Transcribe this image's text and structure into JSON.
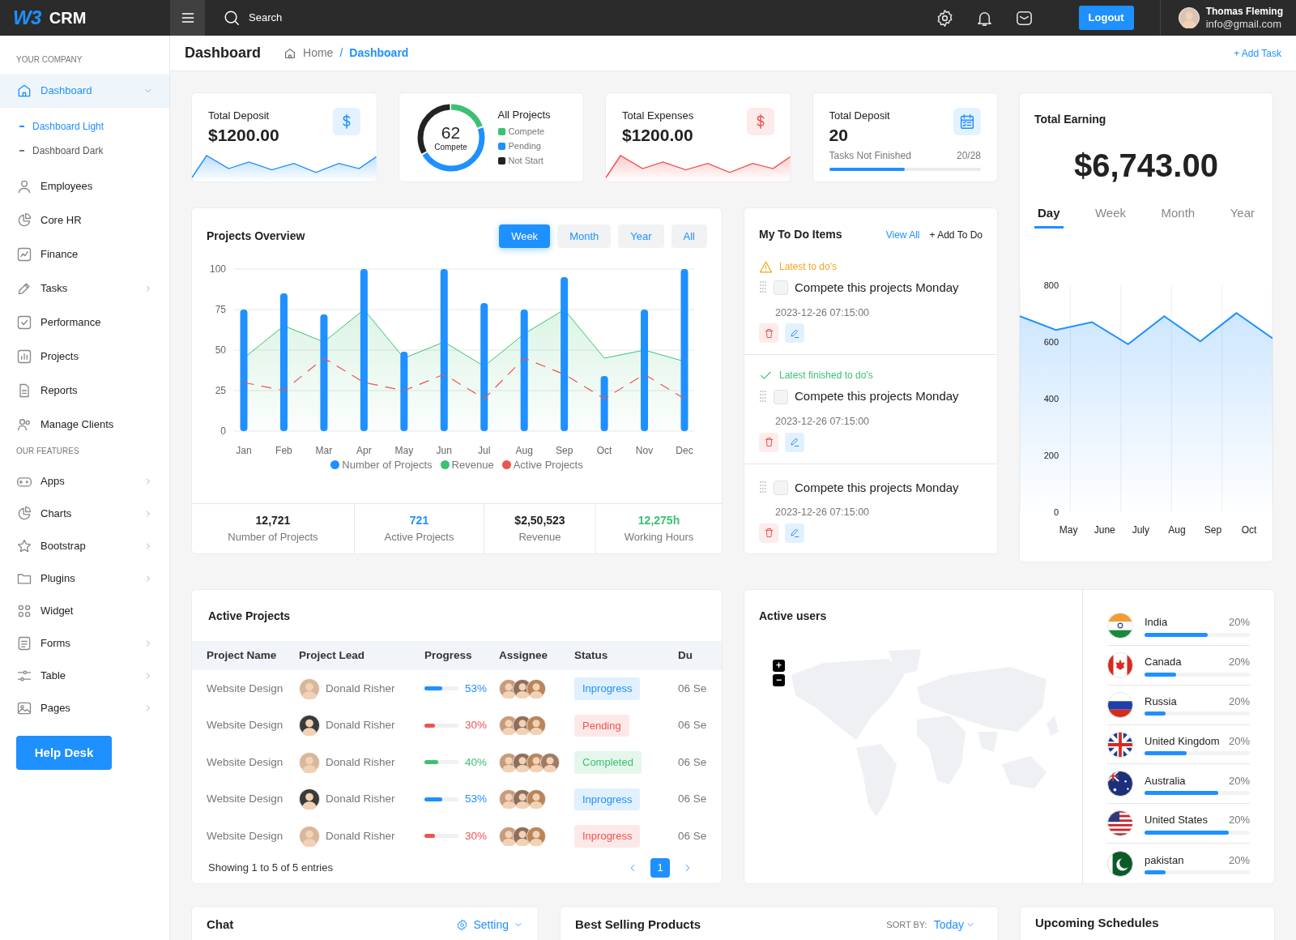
{
  "header": {
    "logo": "W3",
    "app_name": "CRM",
    "search": {
      "placeholder": "Search"
    },
    "logout": "Logout",
    "user": {
      "name": "Thomas Fleming",
      "email": "info@gmail.com"
    }
  },
  "sidebar": {
    "sections": [
      {
        "title": "YOUR COMPANY",
        "items": [
          {
            "label": "Dashboard",
            "selected": true,
            "expandable": true,
            "expanded": true,
            "children": [
              {
                "label": "Dashboard Light",
                "selected": true
              },
              {
                "label": "Dashboard Dark",
                "selected": false
              }
            ]
          },
          {
            "label": "Employees",
            "selected": false,
            "expandable": false
          },
          {
            "label": "Core HR",
            "selected": false,
            "expandable": false
          },
          {
            "label": "Finance",
            "selected": false,
            "expandable": false
          },
          {
            "label": "Tasks",
            "selected": false,
            "expandable": true,
            "expanded": false
          },
          {
            "label": "Performance",
            "selected": false,
            "expandable": false
          },
          {
            "label": "Projects",
            "selected": false,
            "expandable": false
          },
          {
            "label": "Reports",
            "selected": false,
            "expandable": false
          },
          {
            "label": "Manage Clients",
            "selected": false,
            "expandable": false
          }
        ]
      },
      {
        "title": "OUR FEATURES",
        "items": [
          {
            "label": "Apps",
            "selected": false,
            "expandable": true,
            "expanded": false
          },
          {
            "label": "Charts",
            "selected": false,
            "expandable": true,
            "expanded": false
          },
          {
            "label": "Bootstrap",
            "selected": false,
            "expandable": true,
            "expanded": false
          },
          {
            "label": "Plugins",
            "selected": false,
            "expandable": true,
            "expanded": false
          },
          {
            "label": "Widget",
            "selected": false,
            "expandable": false
          },
          {
            "label": "Forms",
            "selected": false,
            "expandable": true,
            "expanded": false
          },
          {
            "label": "Table",
            "selected": false,
            "expandable": true,
            "expanded": false
          },
          {
            "label": "Pages",
            "selected": false,
            "expandable": true,
            "expanded": false
          }
        ]
      }
    ],
    "help_button": "Help Desk"
  },
  "page_header": {
    "title": "Dashboard",
    "breadcrumb": [
      {
        "label": "Home",
        "selected": false
      },
      {
        "label": "Dashboard",
        "selected": true
      }
    ],
    "separator": "/",
    "add_task": "+ Add Task"
  },
  "stat_cards": [
    {
      "kind": "sparkline",
      "title": "Total Deposit",
      "value": "$1200.00",
      "color": "#1e90ff"
    },
    {
      "kind": "donut",
      "center_value": "62",
      "center_label": "Compete",
      "title": "All Projects",
      "legend": [
        {
          "label": "Compete",
          "color": "#3cc172"
        },
        {
          "label": "Pending",
          "color": "#1e90ff"
        },
        {
          "label": "Not Start",
          "color": "#222222"
        }
      ]
    },
    {
      "kind": "sparkline",
      "title": "Total Expenses",
      "value": "$1200.00",
      "color": "#ef5350"
    },
    {
      "kind": "tasks",
      "title": "Total Deposit",
      "value": "20",
      "caption": "Tasks Not Finished",
      "reading": "20/28",
      "level": 0.5
    }
  ],
  "projects_overview": {
    "title": "Projects Overview",
    "tabs": [
      {
        "label": "Week",
        "selected": true
      },
      {
        "label": "Month",
        "selected": false
      },
      {
        "label": "Year",
        "selected": false
      },
      {
        "label": "All",
        "selected": false
      }
    ],
    "chart_data": {
      "type": "bar",
      "grid": true,
      "categories": [
        "Jan",
        "Feb",
        "Mar",
        "Apr",
        "May",
        "Jun",
        "Jul",
        "Aug",
        "Sep",
        "Oct",
        "Nov",
        "Dec"
      ],
      "ylim": [
        0,
        100
      ],
      "yticks": [
        0,
        25,
        50,
        75,
        100
      ],
      "series": [
        {
          "name": "Number of Projects",
          "color": "#1e90ff",
          "values": [
            75,
            85,
            72,
            100,
            49,
            100,
            79,
            75,
            95,
            34,
            75,
            100
          ]
        },
        {
          "name": "Revenue",
          "color": "#3cc172",
          "type": "area",
          "values": [
            45,
            65,
            55,
            75,
            45,
            55,
            40,
            60,
            75,
            45,
            50,
            43
          ]
        },
        {
          "name": "Active Projects",
          "color": "#ef5350",
          "type": "line",
          "line_style": "dashed",
          "values": [
            30,
            25,
            45,
            30,
            25,
            35,
            20,
            45,
            35,
            20,
            35,
            20
          ]
        }
      ]
    },
    "stats": [
      {
        "value": "12,721",
        "label": "Number of Projects",
        "color": "#222222"
      },
      {
        "value": "721",
        "label": "Active Projects",
        "color": "#1e90ff"
      },
      {
        "value": "$2,50,523",
        "label": "Revenue",
        "color": "#222222"
      },
      {
        "value": "12,275h",
        "label": "Working Hours",
        "color": "#3cc172"
      }
    ]
  },
  "todo": {
    "title": "My To Do Items",
    "view_all": "View All",
    "add": "+ Add To Do",
    "groups": [
      {
        "heading": {
          "kind": "warning",
          "text": "Latest to do's"
        },
        "task": "Compete this projects Monday",
        "checked": false,
        "date": "2023-12-26 07:15:00"
      },
      {
        "heading": {
          "kind": "done",
          "text": "Latest finished to do's"
        },
        "task": "Compete this projects Monday",
        "checked": false,
        "date": "2023-12-26 07:15:00"
      },
      {
        "task": "Compete this projects Monday",
        "checked": false,
        "date": "2023-12-26 07:15:00"
      }
    ]
  },
  "earning": {
    "title": "Total Earning",
    "amount": "$6,743.00",
    "tabs": [
      {
        "label": "Day",
        "selected": true
      },
      {
        "label": "Week",
        "selected": false
      },
      {
        "label": "Month",
        "selected": false
      },
      {
        "label": "Year",
        "selected": false
      }
    ],
    "chart_data": {
      "type": "area",
      "categories": [
        null,
        "May",
        "June",
        "July",
        "Aug",
        "Sep",
        "Oct",
        null
      ],
      "ylim": [
        0,
        800
      ],
      "yticks": [
        0,
        200,
        400,
        600,
        800
      ],
      "series": [
        {
          "color": "#1e90ff",
          "values": [
            691,
            642,
            670,
            592,
            691,
            602,
            702,
            613
          ]
        }
      ]
    }
  },
  "active_projects": {
    "title": "Active Projects",
    "columns": [
      "Project Name",
      "Project Lead",
      "Progress",
      "Assignee",
      "Status",
      "Du"
    ],
    "rows": [
      {
        "name": "Website Design",
        "lead": "Donald Risher",
        "progress": {
          "level": 0.53,
          "text": "53%",
          "color": "#1e90ff"
        },
        "status": {
          "text": "Inprogress",
          "color": "#1e90ff"
        },
        "due": "06 Se"
      },
      {
        "name": "Website Design",
        "lead": "Donald Risher",
        "progress": {
          "level": 0.3,
          "text": "30%",
          "color": "#ef5350"
        },
        "status": {
          "text": "Pending",
          "color": "#ef5350"
        },
        "due": "06 Se"
      },
      {
        "name": "Website Design",
        "lead": "Donald Risher",
        "progress": {
          "level": 0.4,
          "text": "40%",
          "color": "#3cc172"
        },
        "status": {
          "text": "Completed",
          "color": "#3cc172"
        },
        "due": "06 Se"
      },
      {
        "name": "Website Design",
        "lead": "Donald Risher",
        "progress": {
          "level": 0.53,
          "text": "53%",
          "color": "#1e90ff"
        },
        "status": {
          "text": "Inprogress",
          "color": "#1e90ff"
        },
        "due": "06 Se"
      },
      {
        "name": "Website Design",
        "lead": "Donald Risher",
        "progress": {
          "level": 0.3,
          "text": "30%",
          "color": "#ef5350"
        },
        "status": {
          "text": "Inprogress",
          "color": "#ef5350"
        },
        "due": "06 Se"
      }
    ],
    "footer": "Showing 1 to 5 of 5 entries",
    "pages": [
      {
        "label": "1",
        "selected": true
      }
    ]
  },
  "active_users": {
    "title": "Active users",
    "zoom_in": "+",
    "zoom_out": "−",
    "countries": [
      {
        "name": "India",
        "reading": "20%",
        "level": 0.6
      },
      {
        "name": "Canada",
        "reading": "20%",
        "level": 0.3
      },
      {
        "name": "Russia",
        "reading": "20%",
        "level": 0.2
      },
      {
        "name": "United Kingdom",
        "reading": "20%",
        "level": 0.4
      },
      {
        "name": "Australia",
        "reading": "20%",
        "level": 0.7
      },
      {
        "name": "United States",
        "reading": "20%",
        "level": 0.8
      },
      {
        "name": "pakistan",
        "reading": "20%",
        "level": 0.2
      }
    ]
  },
  "chat": {
    "title": "Chat",
    "setting": "Setting"
  },
  "best_selling": {
    "title": "Best Selling Products",
    "sort_label": "SORT BY:",
    "sort_value": "Today"
  },
  "schedules": {
    "title": "Upcoming Schedules"
  }
}
